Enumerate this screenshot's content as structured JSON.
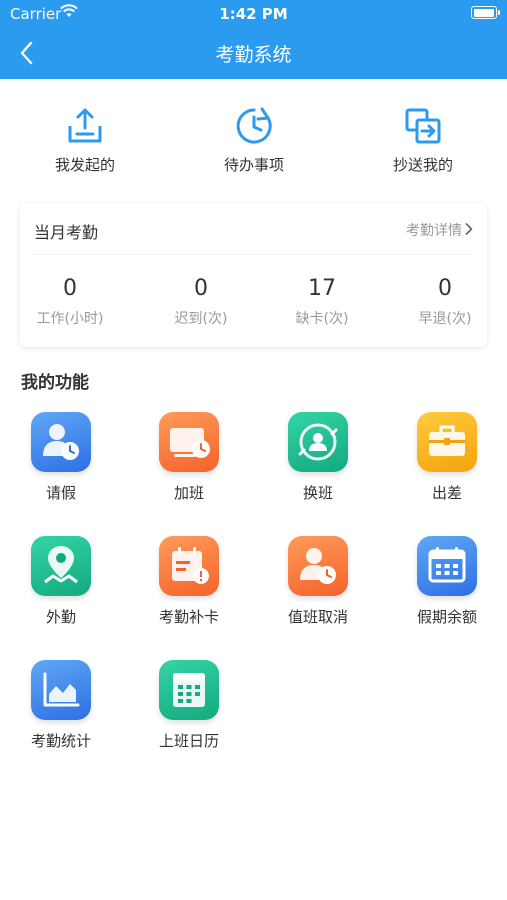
{
  "status": {
    "carrier": "Carrier",
    "time": "1:42 PM",
    "battery_level": 1.0
  },
  "nav": {
    "title": "考勤系统",
    "back_icon": "chevron-left-icon"
  },
  "quick_actions": [
    {
      "label": "我发起的",
      "icon": "upload-tray-icon",
      "color": "#2b9bf0"
    },
    {
      "label": "待办事项",
      "icon": "clock-history-icon",
      "color": "#2b9bf0"
    },
    {
      "label": "抄送我的",
      "icon": "copy-forward-icon",
      "color": "#2b9bf0"
    }
  ],
  "attendance_card": {
    "title": "当月考勤",
    "detail_link": "考勤详情",
    "stats": [
      {
        "value": "0",
        "label": "工作(小时)"
      },
      {
        "value": "0",
        "label": "迟到(次)"
      },
      {
        "value": "17",
        "label": "缺卡(次)"
      },
      {
        "value": "0",
        "label": "早退(次)"
      }
    ]
  },
  "functions_title": "我的功能",
  "functions": [
    {
      "label": "请假",
      "icon": "person-clock-icon",
      "colors": [
        "#5fa8f6",
        "#2e6fe3"
      ]
    },
    {
      "label": "加班",
      "icon": "screen-clock-icon",
      "colors": [
        "#ff9b5a",
        "#f4622a"
      ]
    },
    {
      "label": "换班",
      "icon": "person-swap-icon",
      "colors": [
        "#34d4a6",
        "#13a97e"
      ]
    },
    {
      "label": "出差",
      "icon": "briefcase-icon",
      "colors": [
        "#ffcb3d",
        "#f5a20e"
      ]
    },
    {
      "label": "外勤",
      "icon": "location-pin-icon",
      "colors": [
        "#34d4a6",
        "#13a97e"
      ]
    },
    {
      "label": "考勤补卡",
      "icon": "calendar-alert-icon",
      "colors": [
        "#ff9b5a",
        "#f4622a"
      ]
    },
    {
      "label": "值班取消",
      "icon": "person-clock-icon",
      "colors": [
        "#ff9b5a",
        "#f4622a"
      ]
    },
    {
      "label": "假期余额",
      "icon": "calendar-grid-icon",
      "colors": [
        "#5fa8f6",
        "#2e6fe3"
      ]
    },
    {
      "label": "考勤统计",
      "icon": "area-chart-icon",
      "colors": [
        "#5fa8f6",
        "#2e6fe3"
      ]
    },
    {
      "label": "上班日历",
      "icon": "calendar-grid-icon",
      "colors": [
        "#34d4a6",
        "#13a97e"
      ]
    }
  ]
}
